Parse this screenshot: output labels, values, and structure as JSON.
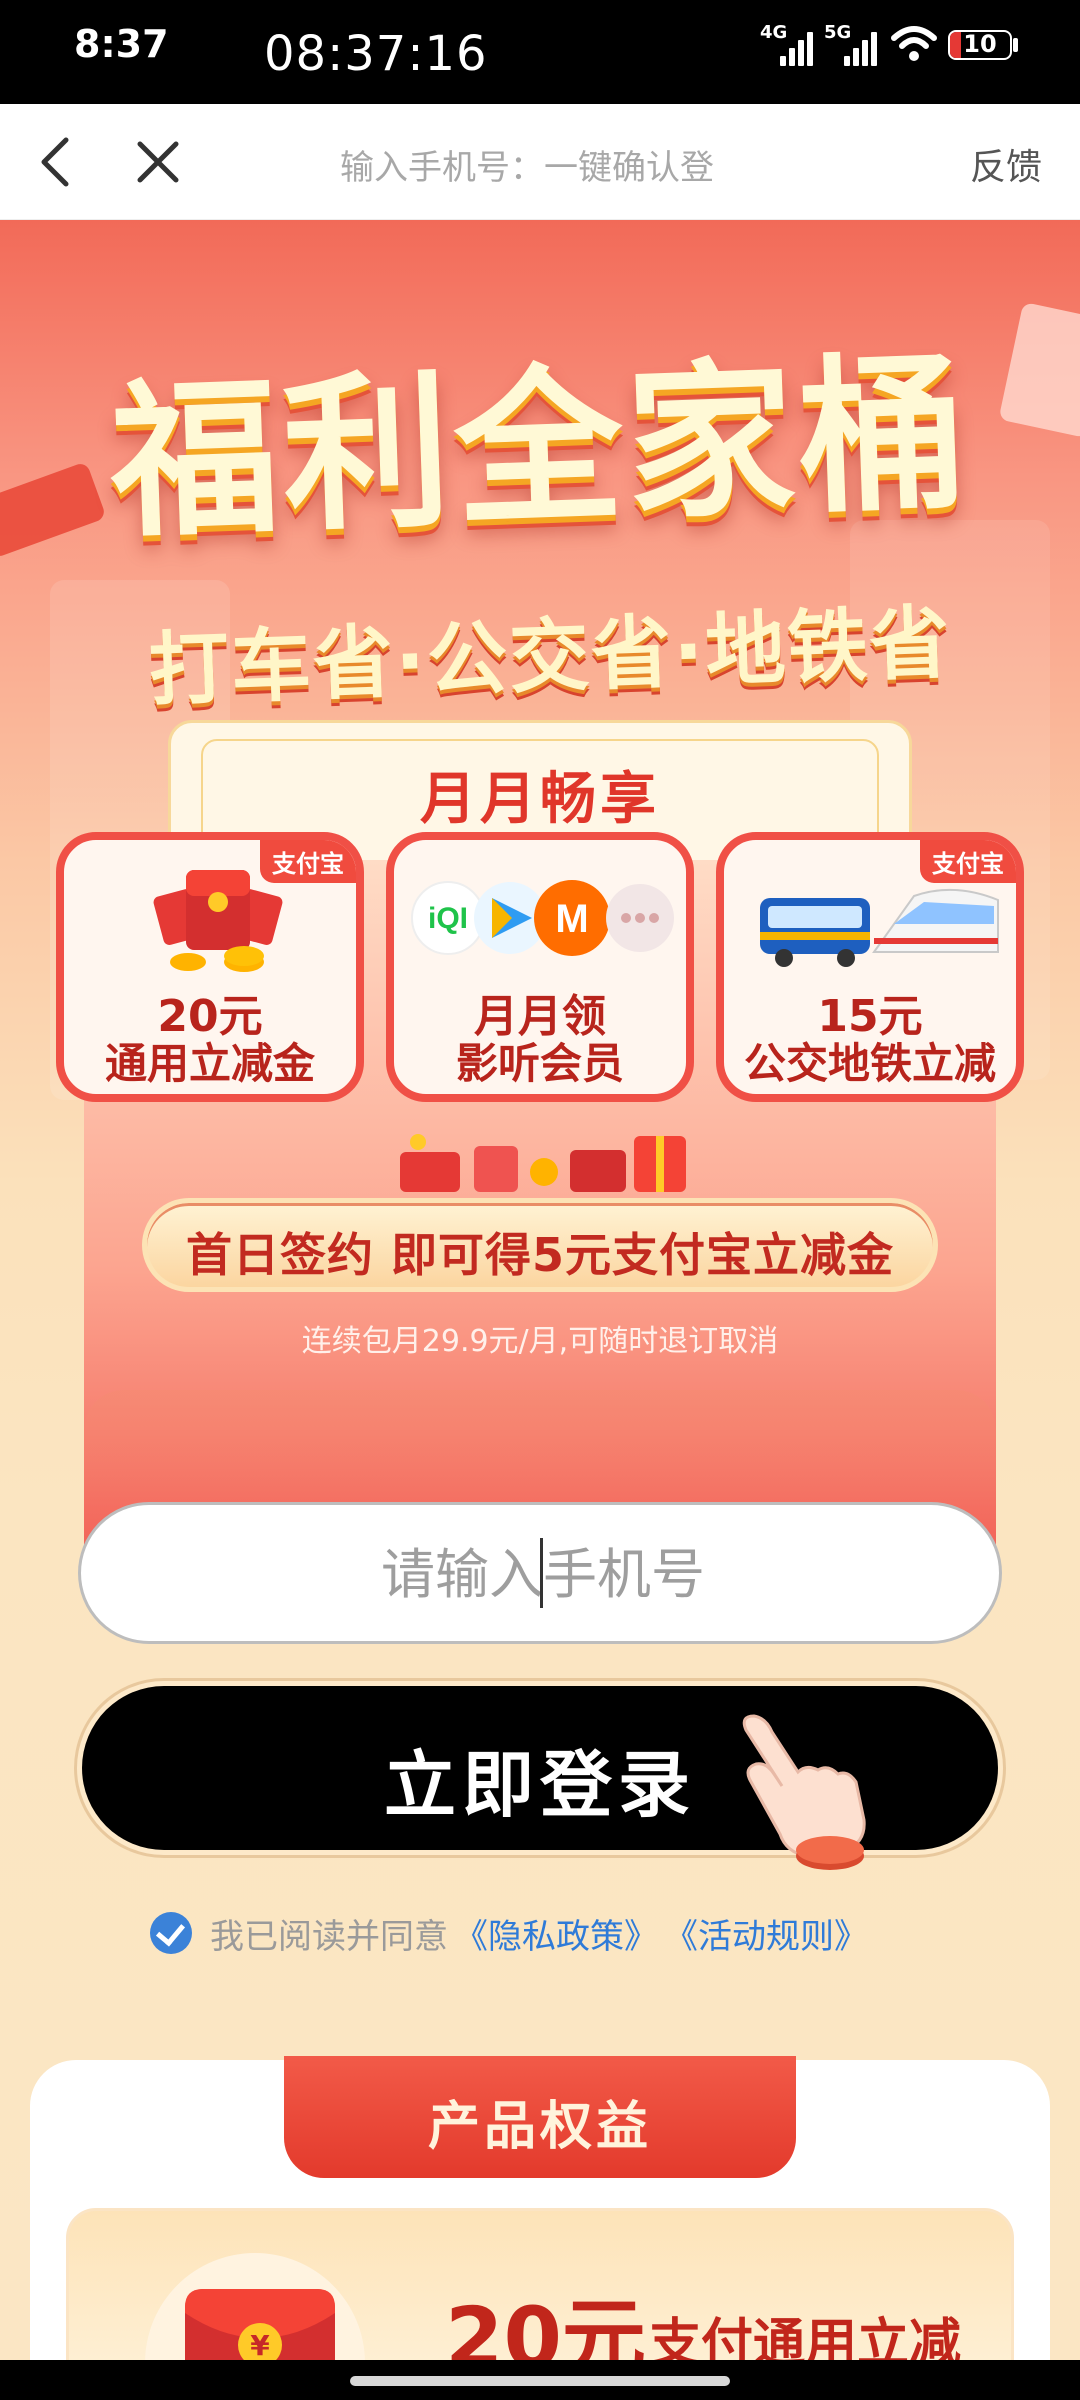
{
  "status_bar": {
    "time": "8:37",
    "clock": "08:37:16",
    "signal1_label": "4G",
    "signal2_label": "5G",
    "battery": "10"
  },
  "nav": {
    "title": "输入手机号：一键确认登",
    "feedback": "反馈"
  },
  "hero": {
    "title": "福利全家桶",
    "subtitle": "打车省·公交省·地铁省"
  },
  "card": {
    "heading": "月月畅享",
    "tiles": [
      {
        "tag": "支付宝",
        "line1": "20元",
        "line2": "通用立减金",
        "icon": "red-packet-icon"
      },
      {
        "tag": "",
        "line1": "月月领",
        "line2": "影听会员",
        "icon": "media-apps-icon"
      },
      {
        "tag": "支付宝",
        "line1": "15元",
        "line2": "公交地铁立减",
        "icon": "bus-train-icon"
      }
    ],
    "promo": "首日签约 即可得5元支付宝立减金",
    "price_note": "连续包月29.9元/月,可随时退订取消"
  },
  "form": {
    "phone_placeholder": "请输入手机号",
    "phone_value": "",
    "login_label": "立即登录"
  },
  "agreement": {
    "checked": true,
    "text": "我已阅读并同意",
    "privacy_link": "《隐私政策》",
    "rules_link": "《活动规则》"
  },
  "benefits": {
    "tab_label": "产品权益",
    "item_amount": "20元",
    "item_desc": "支付通用立减"
  },
  "colors": {
    "accent_red": "#e0362a",
    "link_blue": "#2f7bd8",
    "button_black": "#000000"
  }
}
